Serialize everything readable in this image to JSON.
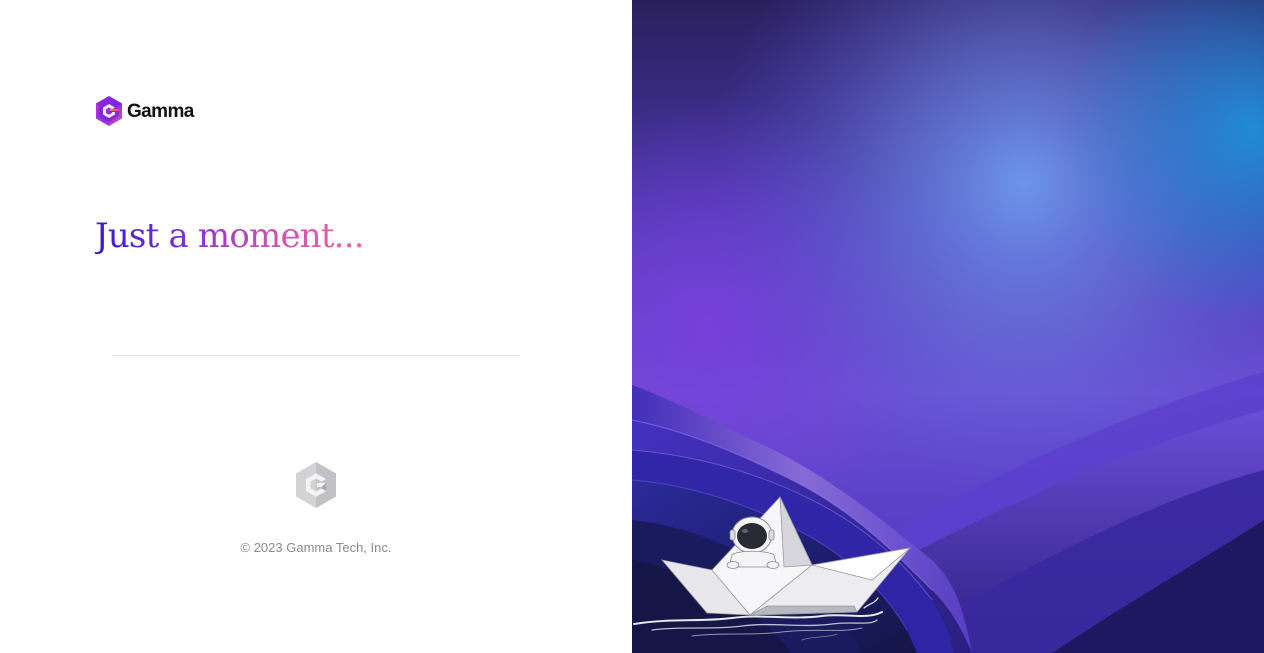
{
  "brand": {
    "name": "Gamma",
    "logo_icon": "gamma-logo-icon"
  },
  "loading": {
    "title": "Just a moment..."
  },
  "footer": {
    "logo_icon": "gamma-logo-grey-icon",
    "copyright": "© 2023 Gamma Tech, Inc."
  },
  "illustration": {
    "name": "astronaut-paper-boat-illustration"
  },
  "colors": {
    "title_gradient_start": "#3a18d8",
    "title_gradient_end": "#f4679a",
    "sky_top": "#2c1f5e",
    "sky_glow": "#5f93e6",
    "wave_purple": "#5c3fd0",
    "wave_dark": "#151a55"
  }
}
